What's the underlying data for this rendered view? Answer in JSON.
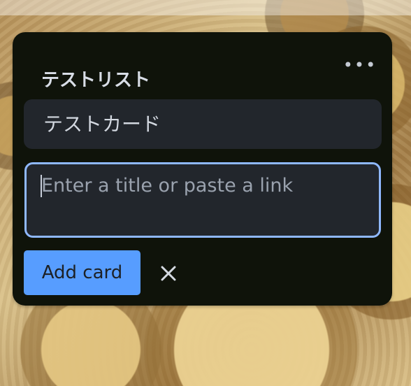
{
  "list": {
    "title": "テストリスト",
    "menu_label": "•••"
  },
  "cards": [
    {
      "title": "テストカード"
    }
  ],
  "composer": {
    "placeholder": "Enter a title or paste a link",
    "add_button_label": "Add card",
    "close_icon": "close-icon"
  }
}
